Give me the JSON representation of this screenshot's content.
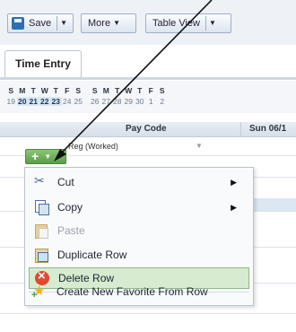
{
  "toolbar": {
    "save_label": "Save",
    "more_label": "More",
    "table_view_label": "Table View"
  },
  "tabs": {
    "active": "Time Entry"
  },
  "calendar": {
    "days_week1": [
      "S",
      "M",
      "T",
      "W",
      "T",
      "F",
      "S"
    ],
    "dates_week1": [
      "19",
      "20",
      "21",
      "22",
      "23",
      "24",
      "25"
    ],
    "days_week2": [
      "S",
      "M",
      "T",
      "W",
      "T",
      "F",
      "S"
    ],
    "dates_week2": [
      "26",
      "27",
      "28",
      "29",
      "30",
      "1",
      "2"
    ]
  },
  "grid": {
    "headers": {
      "pay_code": "Pay Code",
      "sunday": "Sun 06/1"
    },
    "row1_value": "Reg (Worked)"
  },
  "context_menu": {
    "items": [
      {
        "label": "Cut",
        "icon": "scissors-icon",
        "submenu": true
      },
      {
        "label": "Copy",
        "icon": "copy-icon",
        "submenu": true
      },
      {
        "label": "Paste",
        "icon": "paste-icon",
        "disabled": true
      },
      {
        "label": "Duplicate Row",
        "icon": "duplicate-icon"
      },
      {
        "label": "Delete Row",
        "icon": "delete-icon",
        "highlighted": true
      },
      {
        "label": "Create New Favorite From Row",
        "icon": "favorite-add-icon"
      }
    ]
  },
  "colors": {
    "add_button_green": "#5a9e46",
    "highlight_bg": "#d6ebd0",
    "delete_red": "#e04a2f"
  }
}
